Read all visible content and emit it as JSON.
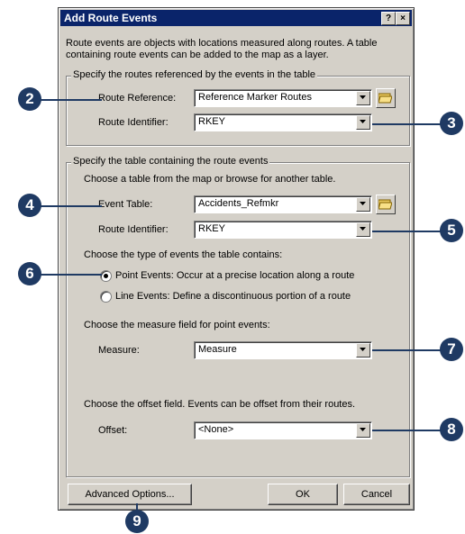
{
  "dialog": {
    "title": "Add Route Events",
    "help_button": "?",
    "close_button": "×",
    "intro": "Route events are objects with locations measured along routes. A table containing route events can be added to the map as a layer."
  },
  "routes_group": {
    "legend": "Specify the routes referenced by the events in the table",
    "route_reference_label": "Route Reference:",
    "route_reference_value": "Reference Marker Routes",
    "route_identifier_label": "Route Identifier:",
    "route_identifier_value": "RKEY"
  },
  "table_group": {
    "legend": "Specify the table containing the route events",
    "instruction": "Choose a table from the map or browse for another table.",
    "event_table_label": "Event Table:",
    "event_table_value": "Accidents_Refmkr",
    "route_identifier_label": "Route Identifier:",
    "route_identifier_value": "RKEY",
    "event_type_prompt": "Choose the type of events the table contains:",
    "point_events_label": "Point Events: Occur at a precise location along a route",
    "line_events_label": "Line Events: Define a discontinuous portion of a route",
    "selected_event_type": "point",
    "measure_prompt": "Choose the measure field for point events:",
    "measure_label": "Measure:",
    "measure_value": "Measure",
    "offset_prompt": "Choose the offset field. Events can be offset from their routes.",
    "offset_label": "Offset:",
    "offset_value": "<None>"
  },
  "buttons": {
    "advanced": "Advanced Options...",
    "ok": "OK",
    "cancel": "Cancel"
  },
  "callouts": [
    "2",
    "3",
    "4",
    "5",
    "6",
    "7",
    "8",
    "9"
  ],
  "colors": {
    "callout": "#1f3a63",
    "titlebar": "#0a246a",
    "dialog_face": "#d4d0c8"
  }
}
